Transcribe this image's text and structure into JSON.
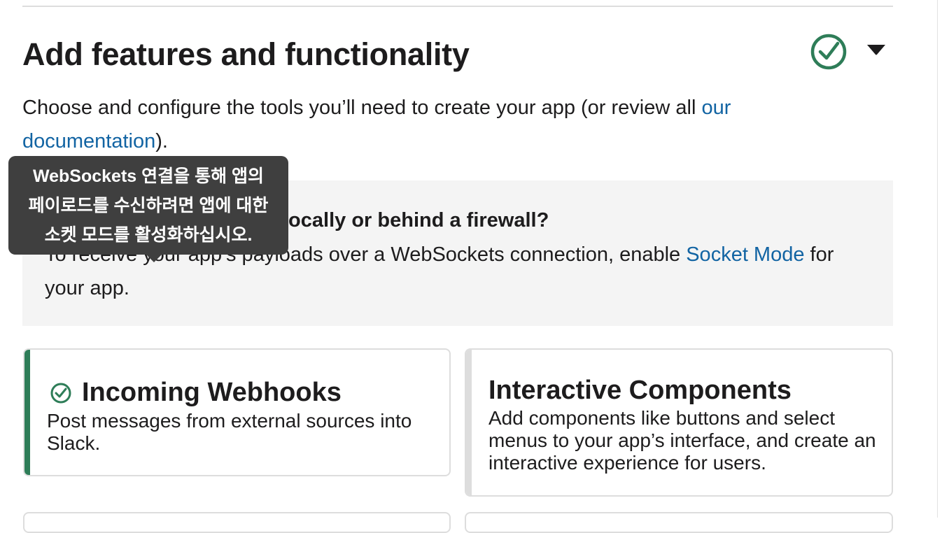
{
  "section": {
    "title": "Add features and functionality"
  },
  "intro": {
    "text": "Choose and configure the tools you’ll need to create your app (or review all ",
    "link": "our documentation",
    "end": ")."
  },
  "callout": {
    "title_visible": "locally or behind a firewall?",
    "body": "To receive your app’s payloads over a WebSockets connection, enable ",
    "link": "Socket Mode",
    "body_end": " for your app."
  },
  "cards": [
    {
      "title": "Incoming Webhooks",
      "description": "Post messages from external sources into Slack.",
      "enabled": true
    },
    {
      "title": "Interactive Components",
      "description": "Add components like buttons and select menus to your app’s interface, and create an interactive experience for users.",
      "enabled": false
    }
  ],
  "tooltip": {
    "lines": [
      "WebSockets 연결을 통해 앱의",
      "페이로드를 수신하려면 앱에 대한",
      "소켓 모드를 활성화하십시오."
    ]
  },
  "icons": {
    "status": "check-circle-icon",
    "toggle": "caret-down-icon"
  },
  "colors": {
    "success": "#2e7d58",
    "link": "#1264a3",
    "tooltip_bg": "#3f3f3f"
  }
}
